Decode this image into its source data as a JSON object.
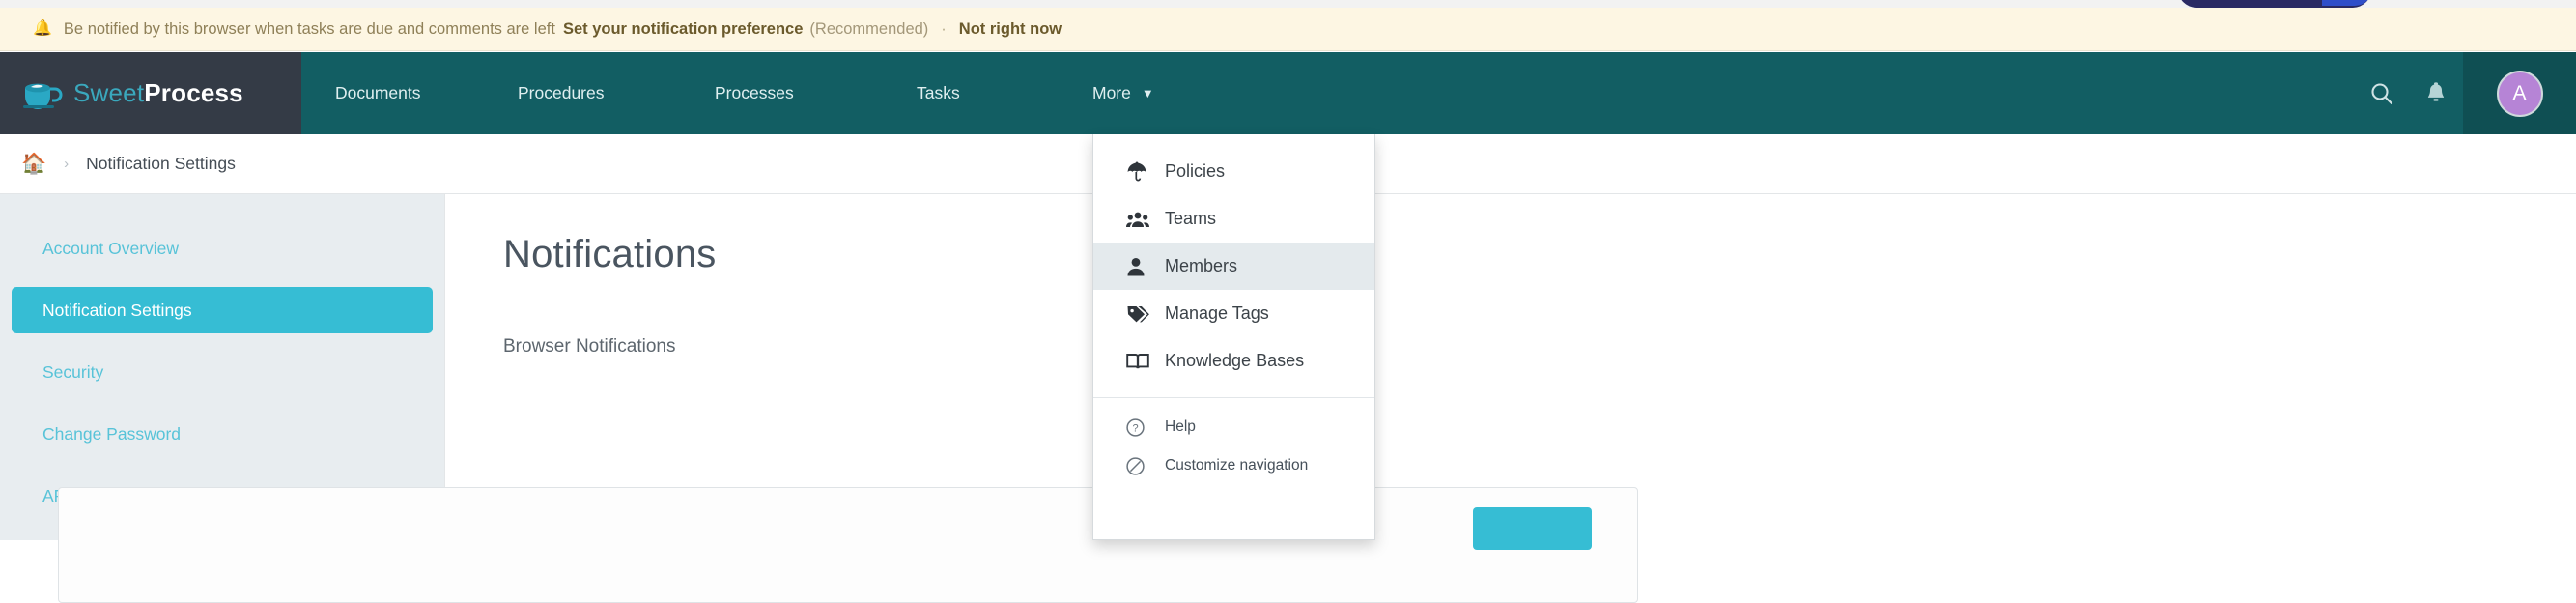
{
  "notification_banner": {
    "icon": "bell-icon",
    "text": "Be notified by this browser when tasks are due and comments are left",
    "link_label": "Set your notification preference",
    "muted_label": "(Recommended)",
    "separator": "·",
    "dismiss_label": "Not right now"
  },
  "navbar": {
    "logo": {
      "name_first": "Sweet",
      "name_second": "Process",
      "icon": "coffee-cup-icon"
    },
    "links": [
      {
        "label": "Documents"
      },
      {
        "label": "Procedures"
      },
      {
        "label": "Processes"
      },
      {
        "label": "Tasks"
      },
      {
        "label": "More",
        "chevron": "⌄"
      }
    ],
    "actions": {
      "search_icon": "search-icon",
      "notifications_icon": "bell-icon",
      "avatar_initial": "A"
    }
  },
  "more_dropdown": {
    "items": [
      {
        "label": "Policies",
        "icon": "umbrella-icon",
        "active": false
      },
      {
        "label": "Teams",
        "icon": "users-icon",
        "active": false
      },
      {
        "label": "Members",
        "icon": "user-icon",
        "active": true
      },
      {
        "label": "Manage Tags",
        "icon": "tag-icon",
        "active": false
      },
      {
        "label": "Knowledge Bases",
        "icon": "open-book-icon",
        "active": false
      }
    ],
    "footer_items": [
      {
        "label": "Help",
        "icon": "question-circle-icon"
      },
      {
        "label": "Customize navigation",
        "icon": "slash-circle-icon"
      }
    ]
  },
  "breadcrumb": {
    "home_icon": "home-icon",
    "chevron": "›",
    "current": "Notification Settings"
  },
  "sidebar": {
    "items": [
      {
        "label": "Account Overview",
        "active": false
      },
      {
        "label": "Notification Settings",
        "active": true
      },
      {
        "label": "Security",
        "active": false
      },
      {
        "label": "Change Password",
        "active": false
      },
      {
        "label": "API",
        "active": false
      }
    ]
  },
  "main": {
    "title": "Notifications",
    "subtitle": "Browser Notifications",
    "panel": {
      "field_placeholder": "",
      "save_label": ""
    }
  },
  "colors": {
    "navbar_teal": "#125e63",
    "logo_block": "#343b46",
    "accent_cyan": "#36bdd4",
    "banner_bg": "#fdf6e3",
    "sidebar_bg": "#e8edf0",
    "avatar": "#b684d6"
  }
}
